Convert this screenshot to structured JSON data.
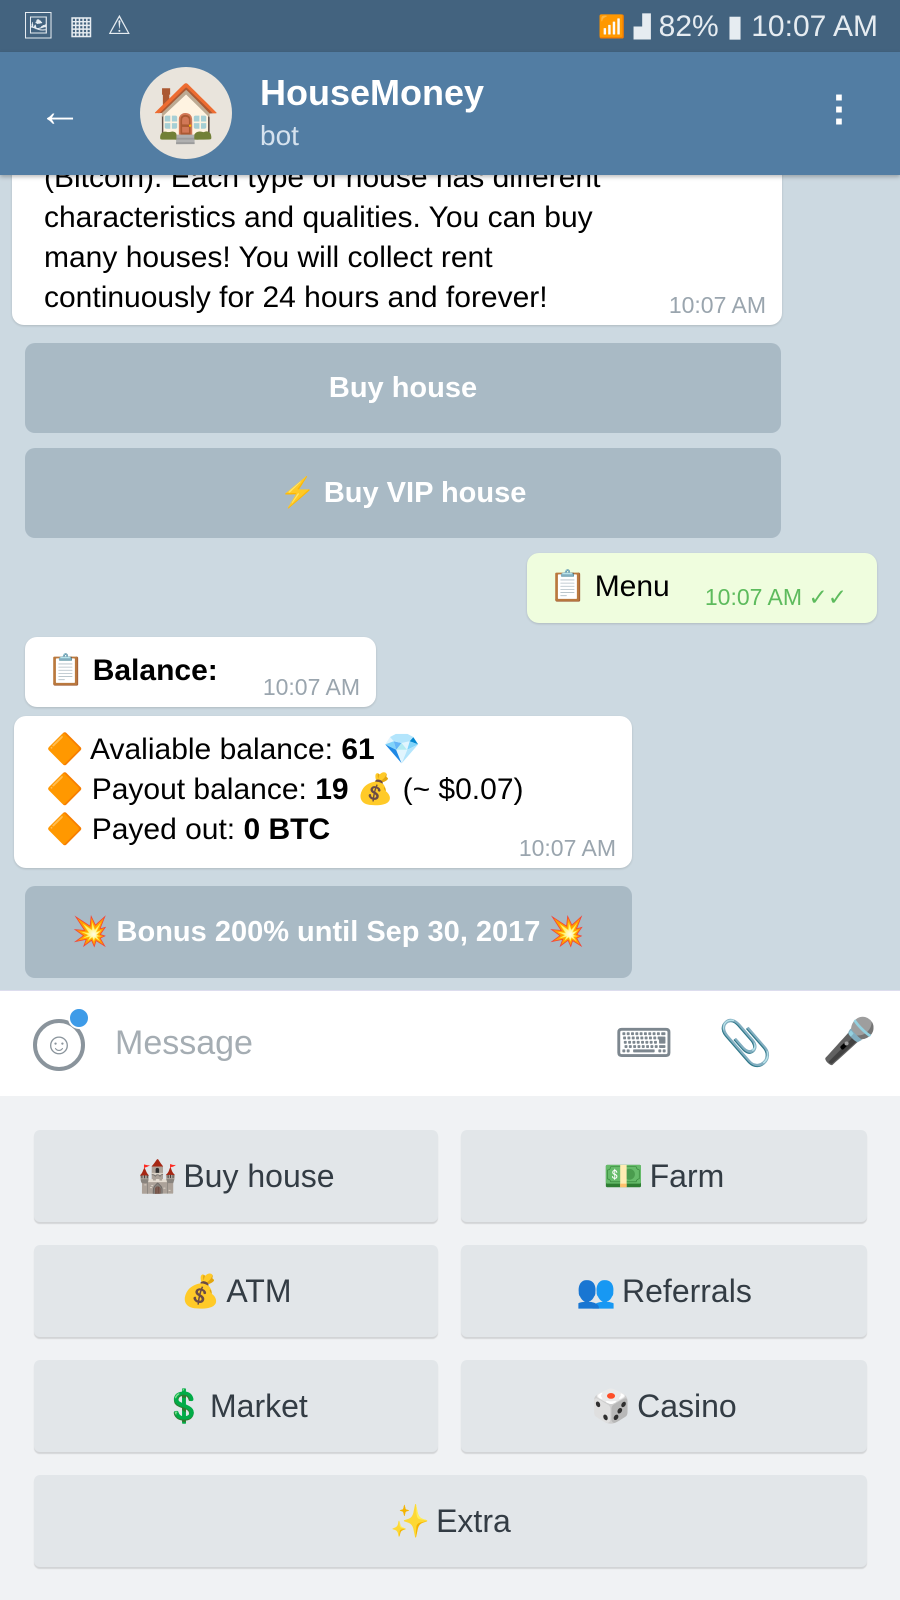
{
  "status_bar": {
    "icons_left": [
      "image-icon",
      "sim-card-icon",
      "warning-icon"
    ],
    "battery": "82%",
    "time": "10:07 AM"
  },
  "header": {
    "title": "HouseMoney",
    "subtitle": "bot"
  },
  "messages": [
    {
      "text_lines": [
        "(Bitcoin). Each type of house has different",
        "characteristics and qualities. You can buy",
        "many houses! You will collect rent",
        "continuously for 24 hours and forever!"
      ],
      "time": "10:07 AM"
    },
    {
      "text": "📋 Menu",
      "time": "10:07 AM",
      "outgoing": true
    },
    {
      "label": "📋",
      "bold": "Balance:",
      "time": "10:07 AM"
    },
    {
      "lines": [
        {
          "prefix": "🔶 Avaliable balance: ",
          "bold": "61",
          "suffix": " 💎"
        },
        {
          "prefix": "🔶 Payout balance: ",
          "bold": "19",
          "suffix": " 💰 (~ $0.07)"
        },
        {
          "prefix": "🔶 Payed out:  ",
          "bold": "0 BTC",
          "suffix": ""
        }
      ],
      "time": "10:07 AM"
    }
  ],
  "inline_buttons": [
    "Buy house",
    "⚡ Buy VIP house",
    "💥 Bonus 200% until Sep 30, 2017 💥"
  ],
  "input": {
    "placeholder": "Message"
  },
  "keyboard": [
    {
      "icon": "🏰",
      "label": "Buy house"
    },
    {
      "icon": "💵",
      "label": "Farm"
    },
    {
      "icon": "💰",
      "label": "ATM"
    },
    {
      "icon": "👥",
      "label": "Referrals"
    },
    {
      "icon": "💲",
      "label": "Market"
    },
    {
      "icon": "🎲",
      "label": "Casino"
    },
    {
      "icon": "✨",
      "label": "Extra"
    }
  ],
  "colors": {
    "header": "#527da3",
    "status": "#43637f",
    "outgoing_bubble": "#effdde",
    "tick": "#5dbb5d"
  }
}
